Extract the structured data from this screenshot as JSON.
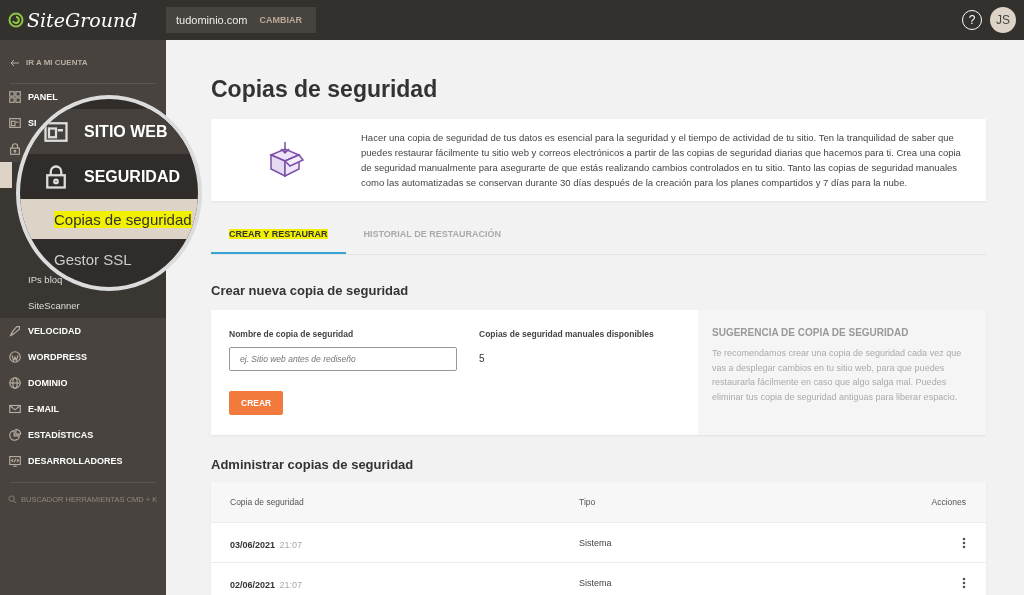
{
  "header": {
    "logo": "SiteGround",
    "domain": "tudominio.com",
    "change": "CAMBIAR",
    "help": "?",
    "avatar": "JS"
  },
  "sidebar": {
    "back": "IR A MI CUENTA",
    "top": [
      {
        "label": "PANEL"
      },
      {
        "label": "SI"
      }
    ],
    "subs": [
      {
        "selected": true
      },
      {
        "label": "IPs bloq",
        "selected": false
      },
      {
        "label": "SiteScanner",
        "selected": false
      }
    ],
    "items": [
      {
        "label": "VELOCIDAD"
      },
      {
        "label": "WORDPRESS"
      },
      {
        "label": "DOMINIO"
      },
      {
        "label": "E-MAIL"
      },
      {
        "label": "ESTADÍSTICAS"
      },
      {
        "label": "DESARROLLADORES"
      }
    ],
    "search": "BUSCADOR HERRAMIENTAS CMD + K"
  },
  "magnifier": {
    "items": [
      {
        "label": "SITIO WEB",
        "kind": "main"
      },
      {
        "label": "SEGURIDAD",
        "kind": "main"
      },
      {
        "label": "Copias de seguridad",
        "kind": "sub",
        "selected": true
      },
      {
        "label": "Gestor SSL",
        "kind": "sub",
        "selected": false
      }
    ]
  },
  "page": {
    "title": "Copias de seguridad",
    "info": "Hacer una copia de seguridad de tus datos es esencial para la seguridad y el tiempo de actividad de tu sitio. Ten la tranquilidad de saber que puedes restaurar fácilmente tu sitio web y correos electrónicos a partir de las copias de seguridad diarias que hacemos para ti. Crea una copia de seguridad manualmente para asegurarte de que estás realizando cambios controlados en tu sitio. Tanto las copias de seguridad manuales como las automatizadas se conservan durante 30 días después de la creación para los planes compartidos y 7 días para la nube.",
    "tabs": [
      {
        "label": "CREAR Y RESTAURAR",
        "selected": true
      },
      {
        "label": "HISTORIAL DE RESTAURACIÓN",
        "selected": false
      }
    ],
    "create": {
      "heading": "Crear nueva copia de seguridad",
      "name_label": "Nombre de copia de seguridad",
      "placeholder": "ej. Sitio web antes de rediseño",
      "available_label": "Copias de seguridad manuales disponibles",
      "available": "5",
      "button": "CREAR",
      "tip_title": "SUGERENCIA DE COPIA DE SEGURIDAD",
      "tip": "Te recomendamos crear una copia de seguridad cada vez que vas a desplegar cambios en tu sitio web, para que puedes restaurarla fácilmente en caso que algo salga mal. Puedes eliminar tus copia de seguridad antiguas para liberar espacio."
    },
    "manage": {
      "heading": "Administrar copias de seguridad",
      "columns": [
        "Copia de seguridad",
        "Tipo",
        "Acciones"
      ],
      "rows": [
        {
          "date": "03/06/2021",
          "time": "21:07",
          "type": "Sistema"
        },
        {
          "date": "02/06/2021",
          "time": "21:07",
          "type": "Sistema"
        }
      ]
    }
  }
}
